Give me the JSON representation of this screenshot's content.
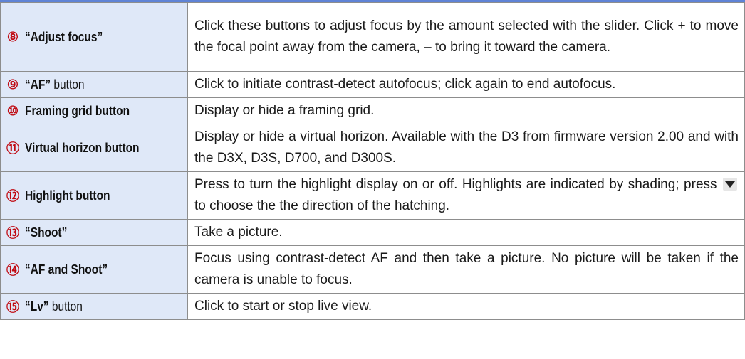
{
  "rows": [
    {
      "num": "⑧",
      "label_bold": "“Adjust focus”",
      "label_plain": "",
      "desc": "Click these buttons to adjust focus by the amount selected with the slider. Click + to move the focal point away from the camera, – to bring it toward the camera."
    },
    {
      "num": "⑨",
      "label_bold": "“AF”",
      "label_plain": " button",
      "desc": "Click to initiate contrast-detect autofocus; click again to end autofocus."
    },
    {
      "num": "⑩",
      "label_bold": "Framing grid button",
      "label_plain": "",
      "desc": "Display or hide a framing grid."
    },
    {
      "num": "⑪",
      "label_bold": "Virtual horizon button",
      "label_plain": "",
      "desc": "Display or hide a virtual horizon. Available with the D3 from firmware version 2.00 and with the D3X, D3S, D700, and D300S."
    },
    {
      "num": "⑫",
      "label_bold": "Highlight button",
      "label_plain": "",
      "desc_before": "Press to turn the highlight display on or off. Highlights are indicated by shading; press",
      "desc_icon": "down-triangle-icon",
      "desc_after": "to choose the the direction of the hatching."
    },
    {
      "num": "⑬",
      "label_bold": "“Shoot”",
      "label_plain": "",
      "desc": "Take a picture."
    },
    {
      "num": "⑭",
      "label_bold": "“AF and Shoot”",
      "label_plain": "",
      "desc": "Focus using contrast-detect AF and then take a picture. No picture will be taken if the camera is unable to focus."
    },
    {
      "num": "⑮",
      "label_bold": "“Lv”",
      "label_plain": " button",
      "desc": "Click to start or stop live view."
    }
  ],
  "colors": {
    "accent": "#c00a12",
    "label_bg": "#dfe8f8",
    "top_rule": "#5f83d6",
    "border": "#8d8d8d"
  }
}
